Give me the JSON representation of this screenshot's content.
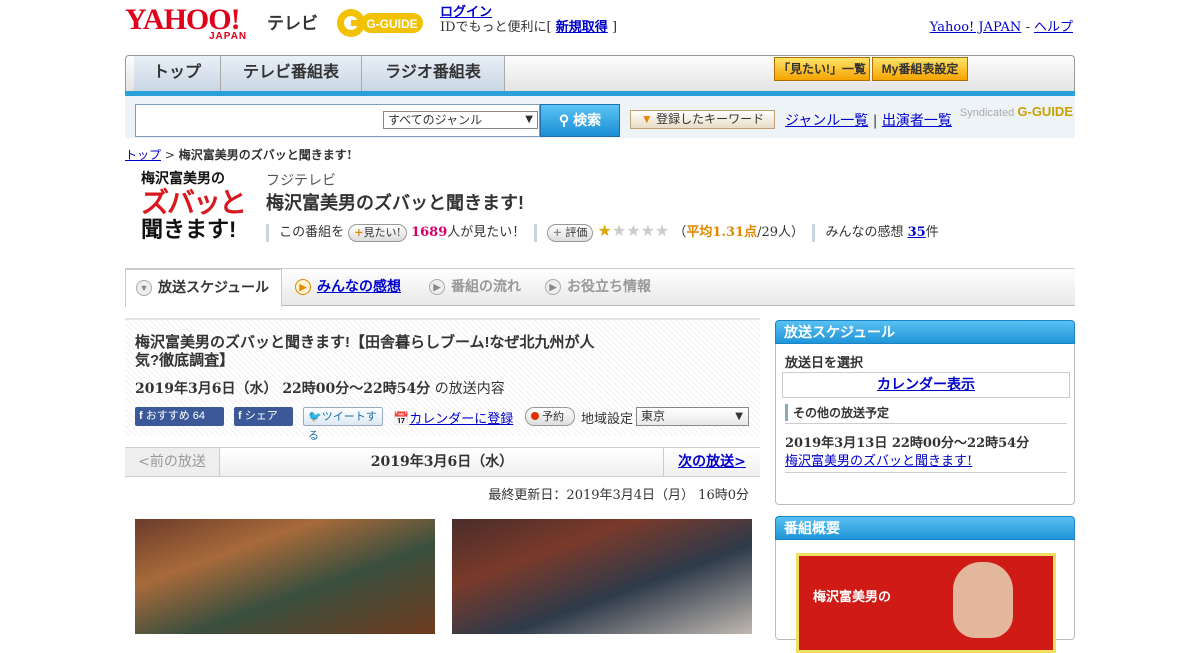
{
  "header": {
    "logo_main": "YAHOO!",
    "logo_sub": "JAPAN",
    "service": "テレビ",
    "gguide": "G-GUIDE",
    "login_link": "ログイン",
    "login_prefix": "IDでもっと便利に[",
    "register_link": "新規取得",
    "login_suffix": "]",
    "yahoo_link": "Yahoo! JAPAN",
    "sep": " - ",
    "help_link": "ヘルプ"
  },
  "nav": {
    "tabs": [
      "トップ",
      "テレビ番組表",
      "ラジオ番組表"
    ],
    "want_list": "「見たい!」一覧",
    "my_settings": "My番組表設定"
  },
  "search": {
    "genre": "すべてのジャンル",
    "button": "検索",
    "keyword_button": "登録したキーワード",
    "genre_list": "ジャンル一覧",
    "divider": "|",
    "cast_list": "出演者一覧",
    "syndicated": "Syndicated",
    "syndicated_brand": "G-GUIDE"
  },
  "breadcrumb": {
    "top": "トップ",
    "sep": " > ",
    "current": "梅沢富美男のズバッと聞きます!"
  },
  "program": {
    "logo_line1": "梅沢富美男の",
    "logo_line2": "ズバッと",
    "logo_line3": "聞きます!",
    "network": "フジテレビ",
    "title": "梅沢富美男のズバッと聞きます!",
    "want_prefix": "この番組を",
    "want_pill": "見たい!",
    "want_count": "1689",
    "want_suffix": "人が見たい！",
    "rate_pill": "評価",
    "rating": 1.31,
    "avg_open": "（",
    "avg_label": "平均1.31点",
    "avg_rest": "/29人）",
    "reviews_label": "みんなの感想",
    "reviews_count": "35",
    "reviews_unit": "件"
  },
  "subtabs": [
    "放送スケジュール",
    "みんなの感想",
    "番組の流れ",
    "お役立ち情報"
  ],
  "episode": {
    "title": "梅沢富美男のズバッと聞きます!【田舎暮らしブーム!なぜ北九州が人気?徹底調査】",
    "date": "2019年3月6日（水） 22時00分～22時54分",
    "date_suffix": "の放送内容",
    "fb_recommend": "おすすめ",
    "fb_count": "64",
    "fb_share": "シェア",
    "tweet": "ツイートする",
    "calendar": "カレンダーに登録",
    "reserve": "予約",
    "area_label": "地域設定",
    "area": "東京",
    "prev": "<前の放送",
    "pager_date": "2019年3月6日（水）",
    "next": "次の放送>",
    "updated": "最終更新日：2019年3月4日（月） 16時0分"
  },
  "sidebar": {
    "schedule_title": "放送スケジュール",
    "select_day": "放送日を選択",
    "calendar_view": "カレンダー表示",
    "other_title": "その他の放送予定",
    "other_date": "2019年3月13日 22時00分～22時54分",
    "other_link": "梅沢富美男のズバッと聞きます!",
    "summary_title": "番組概要",
    "summary_thumb_text": "梅沢富美男の"
  }
}
